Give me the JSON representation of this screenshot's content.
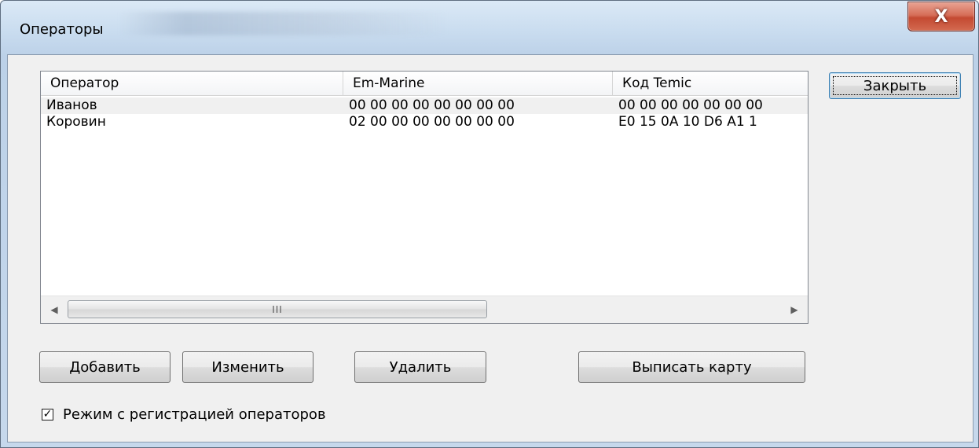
{
  "window": {
    "title": "Операторы",
    "close_glyph": "X"
  },
  "listview": {
    "columns": [
      "Оператор",
      "Em-Marine",
      "Код Temic"
    ],
    "rows": [
      [
        "Иванов",
        "00 00 00 00 00 00 00 00",
        "00 00 00 00 00 00 00"
      ],
      [
        "Коровин",
        "02 00 00 00 00 00 00 00",
        "E0 15 0A 10 D6 A1 1"
      ]
    ],
    "scroll_left": "◀",
    "scroll_right": "▶",
    "thumb_grip": "III"
  },
  "buttons": {
    "close": "Закрыть",
    "add": "Добавить",
    "edit": "Изменить",
    "delete": "Удалить",
    "issue_card": "Выписать карту"
  },
  "checkbox": {
    "label": "Режим с регистрацией операторов",
    "checked": true,
    "check_glyph": "✓"
  }
}
